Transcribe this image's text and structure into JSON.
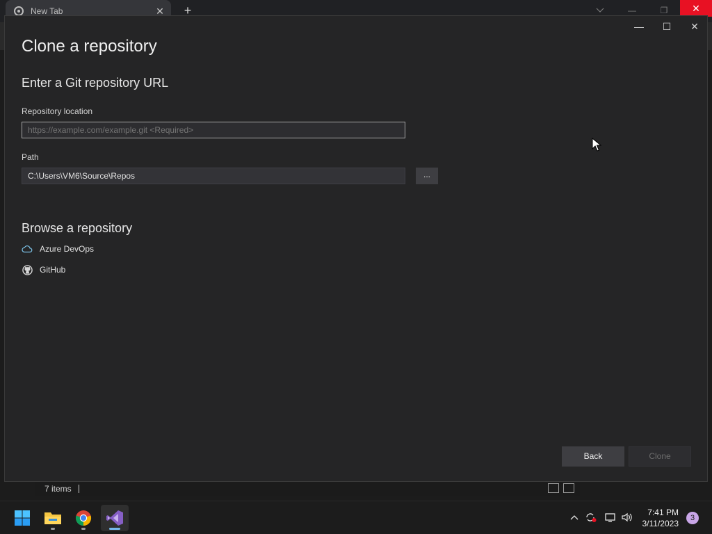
{
  "browser": {
    "tab_title": "New Tab",
    "tab_close_glyph": "✕",
    "new_tab_glyph": "+",
    "icons": [
      "chrome-tab-icon",
      "chevron-down-icon",
      "minimize-icon",
      "restore-icon",
      "close-icon"
    ]
  },
  "dialog": {
    "title": "Clone a repository",
    "url_section_heading": "Enter a Git repository URL",
    "repository_location_label": "Repository location",
    "repository_location_placeholder": "https://example.com/example.git <Required>",
    "repository_location_value": "",
    "path_label": "Path",
    "path_value": "C:\\Users\\VM6\\Source\\Repos",
    "browse_button_label": "...",
    "browse_section_heading": "Browse a repository",
    "providers": [
      {
        "label": "Azure DevOps",
        "icon": "cloud-icon"
      },
      {
        "label": "GitHub",
        "icon": "github-icon"
      }
    ],
    "back_button_label": "Back",
    "clone_button_label": "Clone",
    "clone_enabled": false,
    "window_controls": {
      "minimize": "—",
      "maximize": "☐",
      "close": "✕"
    }
  },
  "explorer_status": {
    "items_count": "7 items"
  },
  "taskbar": {
    "apps": [
      {
        "name": "start",
        "icon": "windows-start-icon"
      },
      {
        "name": "file-explorer",
        "icon": "folder-icon"
      },
      {
        "name": "chrome",
        "icon": "chrome-icon"
      },
      {
        "name": "visual-studio",
        "icon": "visual-studio-icon",
        "active": true
      }
    ],
    "tray": {
      "time": "7:41 PM",
      "date": "3/11/2023",
      "notification_count": "3"
    }
  },
  "colors": {
    "dialog_bg": "#252526",
    "input_border": "#a8a8a8",
    "azure_icon": "#7cc3e8",
    "close_red": "#e81123",
    "notification_badge": "#c9a6e8"
  }
}
